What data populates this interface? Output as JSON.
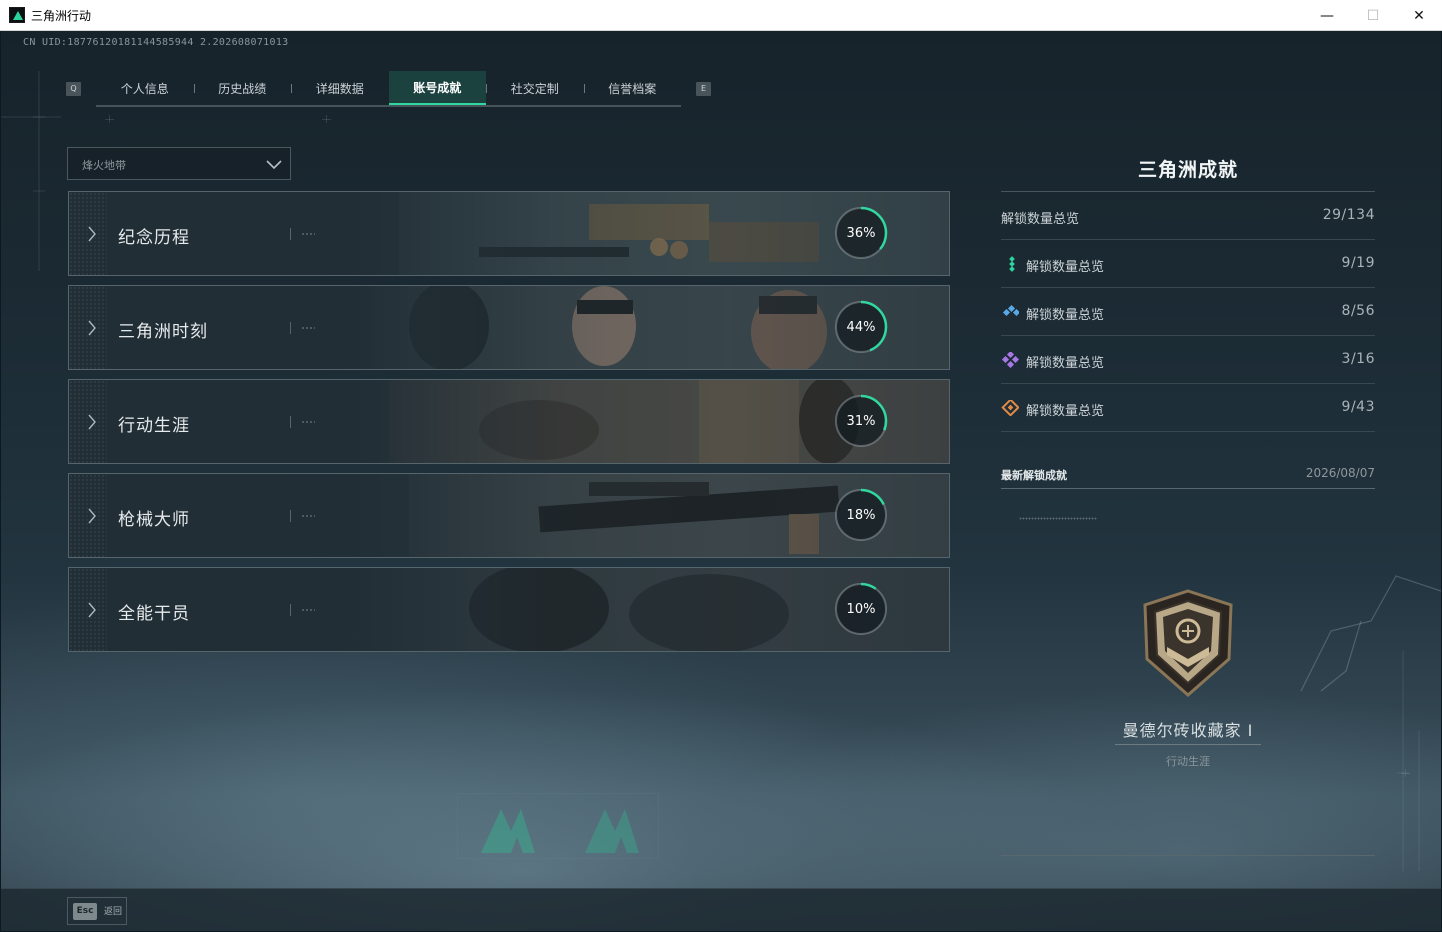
{
  "window": {
    "title": "三角洲行动",
    "controls": {
      "minimize": "—",
      "maximize": "☐",
      "close": "✕"
    }
  },
  "header": {
    "uid": "CN UID:18776120181144585944 2.202608071013"
  },
  "tabs": {
    "left_key": "Q",
    "right_key": "E",
    "items": [
      {
        "label": "个人信息",
        "active": false
      },
      {
        "label": "历史战绩",
        "active": false
      },
      {
        "label": "详细数据",
        "active": false
      },
      {
        "label": "账号成就",
        "active": true
      },
      {
        "label": "社交定制",
        "active": false
      },
      {
        "label": "信誉档案",
        "active": false
      }
    ]
  },
  "mode_select": {
    "selected": "烽火地带"
  },
  "categories": [
    {
      "name": "纪念历程",
      "progress_pct": 36,
      "progress_label": "36%"
    },
    {
      "name": "三角洲时刻",
      "progress_pct": 44,
      "progress_label": "44%"
    },
    {
      "name": "行动生涯",
      "progress_pct": 31,
      "progress_label": "31%"
    },
    {
      "name": "枪械大师",
      "progress_pct": 18,
      "progress_label": "18%"
    },
    {
      "name": "全能干员",
      "progress_pct": 10,
      "progress_label": "10%"
    }
  ],
  "summary": {
    "title": "三角洲成就",
    "total": {
      "label": "解锁数量总览",
      "value": "29/134"
    },
    "tiers": [
      {
        "icon": "green-tier-icon",
        "color": "#2fd39b",
        "label": "解锁数量总览",
        "value": "9/19"
      },
      {
        "icon": "blue-tier-icon",
        "color": "#5aa9e6",
        "label": "解锁数量总览",
        "value": "8/56"
      },
      {
        "icon": "purple-tier-icon",
        "color": "#a877e6",
        "label": "解锁数量总览",
        "value": "3/16"
      },
      {
        "icon": "orange-tier-icon",
        "color": "#e08a45",
        "label": "解锁数量总览",
        "value": "9/43"
      }
    ]
  },
  "latest": {
    "label": "最新解锁成就",
    "date": "2026/08/07",
    "achievement_name": "曼德尔砖收藏家 Ⅰ",
    "achievement_category": "行动生涯"
  },
  "footer": {
    "esc_key": "Esc",
    "esc_label": "返回"
  },
  "colors": {
    "accent": "#31d79e"
  }
}
